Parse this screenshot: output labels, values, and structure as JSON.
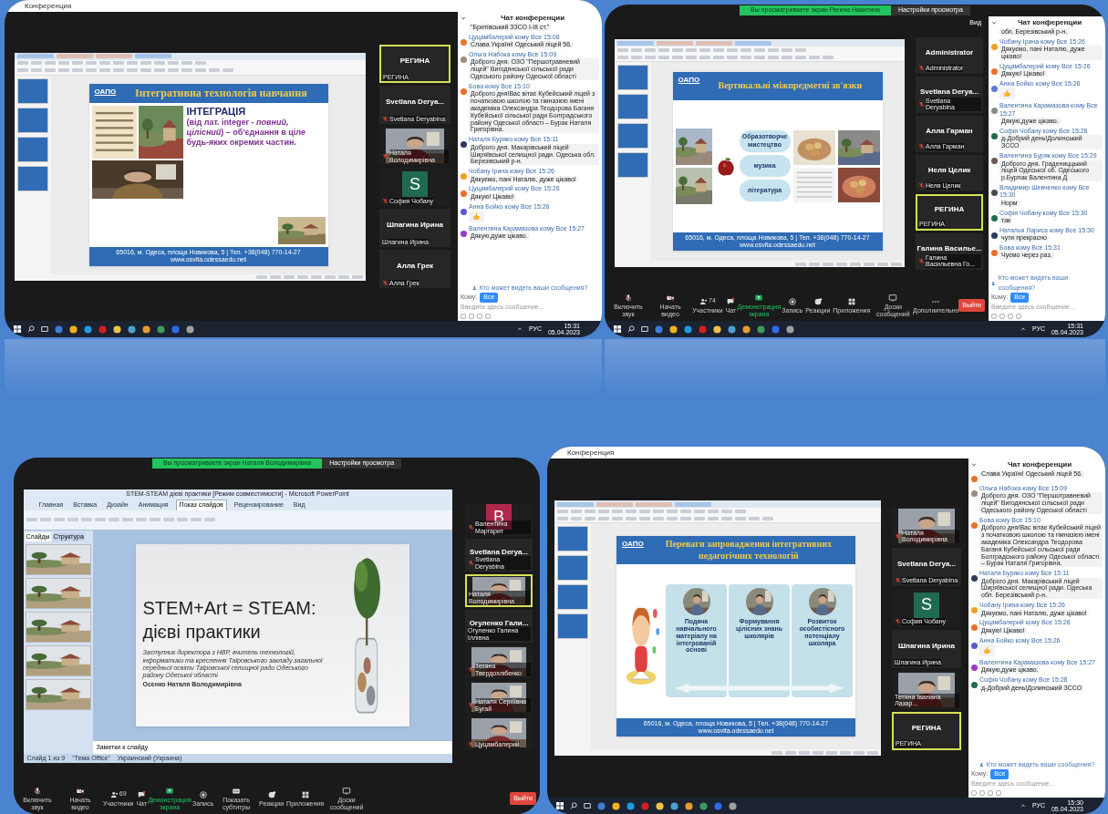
{
  "panels": [
    {
      "window_title": "Конференция",
      "app": {
        "kind": "wps",
        "slide": {
          "kind": "integration",
          "logo": "ОАПО",
          "title": "Інтегративна технологія навчання",
          "heading": "ІНТЕГРАЦІЯ",
          "body": "(від лат. integer - *повний, цілісний*) – об'єднання в ціле будь-яких окремих частин.",
          "footer": "65016, м. Одеса, площа Новикова, 5 | Тел. +38(048) 770-14-27",
          "website": "www.osvita.odessaedu.net"
        }
      },
      "participants": [
        {
          "kind": "name",
          "name": "РЕГИНА",
          "label": "РЕГИНА",
          "muted": false,
          "active": true
        },
        {
          "kind": "name",
          "name": "Svetlana Derya...",
          "label": "Svetlana Deryabina",
          "muted": true,
          "active": false
        },
        {
          "kind": "video",
          "label": "Наталя Володимирівна",
          "muted": true,
          "active": false
        },
        {
          "kind": "avatar",
          "letter": "S",
          "color": "#1f6b4f",
          "label": "София Чобану",
          "muted": true,
          "active": false
        },
        {
          "kind": "name",
          "name": "Шпагина Ирина",
          "label": "Шпагина Ирина",
          "muted": false,
          "active": false
        },
        {
          "kind": "name",
          "name": "Алла Грек",
          "label": "Алла Грек",
          "muted": true,
          "active": false
        }
      ],
      "chat": {
        "title": "Чат конференции",
        "messages": [
          {
            "kind": "text",
            "text": "\"Бритівський ЗЗСО І-ІІІ ст.\""
          },
          {
            "kind": "text",
            "author": "Цуцамбалерий кому Все 15:08",
            "text": "Слава Україні! Одеський ліцей 56.",
            "color": "#e8702a"
          },
          {
            "kind": "text",
            "author": "Ольга Набока кому Все 15:09",
            "text": "Доброго дня. ОЗО \"Першотравневий ліцей\" Вигодянської сільської ради Одеського району Одеської області",
            "color": "#9a8a80"
          },
          {
            "kind": "text",
            "author": "Бова кому Все 15:10",
            "text": "Доброго дня!Вас вітає Кубейський ліцей з початковою школою та гімназією імені академіка Олександра Теодорова Баганя Кубейської сільської ради Болградського району Одеської області – Бурак Наталя Григорівна.",
            "color": "#e8702a"
          },
          {
            "kind": "text",
            "author": "Наталя Буряко кому Все 15:11",
            "text": "Доброго дня. Макарівський ліцей Ширяївської селищної ради. Одеська обл. Березівський р-н.",
            "color": "#2a3a5a"
          },
          {
            "kind": "text",
            "author": "Чобану Ірина кому Все 15:26",
            "text": "Дякуємо, пані Наталю, дуже цікаво!",
            "color": "#f0a020"
          },
          {
            "kind": "text",
            "author": "Цуцамбалерий кому Все 15:26",
            "text": "Дякую! Цікаво!",
            "color": "#e8702a"
          },
          {
            "kind": "reaction",
            "author": "Анна Бойко кому Все 15:26",
            "color": "#5a5ac8"
          },
          {
            "kind": "text",
            "author": "Валентина Карамазова кому Все 15:27",
            "text": "Дякую,дуже цікаво.",
            "color": "#9a3ac8"
          }
        ],
        "who_can_see": "Кто может видеть ваши сообщения?",
        "to_label": "Кому:",
        "to_value": "Все",
        "input_placeholder": "Введите здесь сообщение..."
      },
      "taskbar": {
        "lang": "РУС",
        "time": "15:31",
        "date": "05.04.2023"
      }
    },
    {
      "banner": {
        "text": "Вы просматриваете экран Регина Никитина",
        "button": "Настройки просмотра"
      },
      "view_button": "Вид",
      "app": {
        "kind": "wps",
        "slide": {
          "kind": "vertical",
          "logo": "ОАПО",
          "title": "Вертикальні міжпредметні зв'язки",
          "bubbles": [
            "Образотворче мистецтво",
            "музика",
            "література"
          ],
          "footer": "65016, м. Одеса, площа Новикова, 5 | Тел. +38(048) 770-14-27",
          "website": "www.osvita.odessaedu.net"
        }
      },
      "participants": [
        {
          "kind": "name",
          "name": "Administrator",
          "label": "Administrator",
          "muted": true,
          "active": false
        },
        {
          "kind": "name",
          "name": "Svetlana Derya...",
          "label": "Svetlana Deryabina",
          "muted": true,
          "active": false
        },
        {
          "kind": "name",
          "name": "Алла Гарман",
          "label": "Алла Гарман",
          "muted": true,
          "active": false
        },
        {
          "kind": "name",
          "name": "Неля Целик",
          "label": "Неля Целик",
          "muted": true,
          "active": false
        },
        {
          "kind": "name",
          "name": "РЕГИНА",
          "label": "РЕГИНА",
          "muted": false,
          "active": true
        },
        {
          "kind": "name",
          "name": "Галина Василье...",
          "label": "Галина Васильевна Го...",
          "muted": true,
          "active": false
        }
      ],
      "chat": {
        "title": "Чат конференции",
        "messages": [
          {
            "kind": "text",
            "text": "обл. Березівський р-н."
          },
          {
            "kind": "text",
            "author": "Чобану Ірина кому Все 15:26",
            "text": "Дякуємо, пані Наталю, дуже цікаво!",
            "color": "#f0a020"
          },
          {
            "kind": "text",
            "author": "Цуцамбалерий кому Все 15:26",
            "text": "Дякую! Цікаво!",
            "color": "#e8702a"
          },
          {
            "kind": "reaction",
            "author": "Анна Бойко кому Все 15:26",
            "color": "#5a7ad8"
          },
          {
            "kind": "text",
            "author": "Валентина Карамазова кому Все 15:27",
            "text": "Дякую,дуже цікаво.",
            "color": "#8a8a8a"
          },
          {
            "kind": "text",
            "author": "Софія Чобану кому Все 15:28",
            "text": "д-Добрий день!Долинський ЗССО",
            "color": "#1f6b4f"
          },
          {
            "kind": "text",
            "author": "Валентина Буряк кому Все 15:29",
            "text": "Доброго дня. Градениццький ліцей Одеської об. Одеського р.Бурлак Валентина Д",
            "color": "#6a5a50"
          },
          {
            "kind": "text",
            "author": "Владимир Шевченко кому Все 15:30",
            "text": "Норм",
            "color": "#4a4a4a"
          },
          {
            "kind": "text",
            "author": "Софія Чобану кому Все 15:30",
            "text": "так",
            "color": "#1f6b4f"
          },
          {
            "kind": "text",
            "author": "Наталья Лариса кому Все 15:30",
            "text": "чути прекрасно",
            "color": "#2a3a5a"
          },
          {
            "kind": "text",
            "author": "Бова кому Все 15:31",
            "text": "Чуємо через раз.",
            "color": "#e8702a"
          }
        ],
        "who_can_see": "Кто может видеть ваши сообщения?",
        "to_label": "Кому:",
        "to_value": "Все",
        "input_placeholder": "Введите здесь сообщение..."
      },
      "toolbar": [
        {
          "kind": "audio",
          "label": "Включить звук"
        },
        {
          "kind": "video",
          "label": "Начать видео"
        },
        {
          "kind": "participants",
          "label": "Участники",
          "count": "74"
        },
        {
          "kind": "chat",
          "label": "Чат"
        },
        {
          "kind": "share",
          "label": "Демонстрация экрана"
        },
        {
          "kind": "record",
          "label": "Запись"
        },
        {
          "kind": "reactions",
          "label": "Реакции"
        },
        {
          "kind": "apps",
          "label": "Приложения"
        },
        {
          "kind": "whiteboards",
          "label": "Доски сообщений"
        },
        {
          "kind": "more",
          "label": "Дополнительно"
        }
      ],
      "leave_button": "Выйти",
      "taskbar": {
        "lang": "РУС",
        "time": "15:31",
        "date": "05.04.2023"
      }
    },
    {
      "banner": {
        "text": "Вы просматриваете экран Наталя Володимирівна",
        "button": "Настройки просмотра"
      },
      "app": {
        "kind": "powerpoint",
        "title": "STEM-STEAM дієві практики [Режим совместимости] - Microsoft PowerPoint",
        "tabs": [
          {
            "label": "Главная",
            "selected": false
          },
          {
            "label": "Вставка",
            "selected": false
          },
          {
            "label": "Дизайн",
            "selected": false
          },
          {
            "label": "Анимация",
            "selected": false
          },
          {
            "label": "Показ слайдов",
            "selected": true
          },
          {
            "label": "Рецензирование",
            "selected": false
          },
          {
            "label": "Вид",
            "selected": false
          }
        ],
        "pane_tabs": [
          {
            "label": "Слайды",
            "selected": true
          },
          {
            "label": "Структура",
            "selected": false
          }
        ],
        "notes": "Заметки к слайду",
        "status": [
          "Слайд 1 из 9",
          "\"Тема Office\"",
          "Украинский (Украина)"
        ],
        "slide": {
          "kind": "stem",
          "title": "STEM+Art = STEAM: дієві практики",
          "caption": "Заступник директора з НВР, вчитель технологій, інформатики та креслення Таїровського закладу загальної середньої освіти Таїровської селищної ради Одеського району Одеської області",
          "author": "Осєнко Наталя Володимирівна"
        }
      },
      "participants": [
        {
          "kind": "avatar",
          "letter": "B",
          "color": "#b0284a",
          "label": "Валентина Маргарит",
          "muted": true,
          "active": false
        },
        {
          "kind": "name",
          "name": "Svetlana Derya...",
          "label": "Svetlana Deryabina",
          "muted": true,
          "active": false
        },
        {
          "kind": "video",
          "label": "Наталя Володимирівна",
          "muted": false,
          "active": true
        },
        {
          "kind": "name",
          "name": "Огуленко Гали...",
          "label": "Огуленко Галина Іллівна",
          "muted": false,
          "active": false
        },
        {
          "kind": "video",
          "label": "Тетяна Твердохлібенко",
          "muted": true,
          "active": false
        },
        {
          "kind": "video",
          "label": "Наталя Сергіївна Бугай",
          "muted": true,
          "active": false
        },
        {
          "kind": "video",
          "label": "Цуцамбалерий",
          "muted": true,
          "active": false
        }
      ],
      "toolbar": [
        {
          "kind": "audio",
          "label": "Включить звук"
        },
        {
          "kind": "video",
          "label": "Начать видео"
        },
        {
          "kind": "participants",
          "label": "Участники",
          "count": "69"
        },
        {
          "kind": "chat",
          "label": "Чат"
        },
        {
          "kind": "share",
          "label": "Демонстрация экрана"
        },
        {
          "kind": "record",
          "label": "Запись"
        },
        {
          "kind": "captions",
          "label": "Показать субтитры"
        },
        {
          "kind": "reactions",
          "label": "Реакции"
        },
        {
          "kind": "apps",
          "label": "Приложения"
        },
        {
          "kind": "whiteboards",
          "label": "Доски сообщений"
        }
      ],
      "leave_button": "Выйти"
    },
    {
      "window_title": "Конференция",
      "app": {
        "kind": "wps",
        "slide": {
          "kind": "advantages",
          "logo": "ОАПО",
          "title": "Переваги запровадження інтегративних педагогічних технологій",
          "cards": [
            "Подача навчального матеріалу на інтегрованій основі",
            "Формування цілісних знань школярів",
            "Розвиток особистісного потенціалу школяра"
          ],
          "footer": "65016, м. Одеса, площа Новикова, 5 | Тел. +38(048) 770-14-27",
          "website": "www.osvita.odessaedu.net"
        }
      },
      "participants": [
        {
          "kind": "video",
          "label": "Наталя Володимирівна",
          "muted": true,
          "active": false
        },
        {
          "kind": "name",
          "name": "Svetlana Derya...",
          "label": "Svetlana Deryabina",
          "muted": true,
          "active": false
        },
        {
          "kind": "avatar",
          "letter": "S",
          "color": "#1f6b4f",
          "label": "София Чобану",
          "muted": true,
          "active": false
        },
        {
          "kind": "name",
          "name": "Шпагина Ирина",
          "label": "Шпагина Ирина",
          "muted": false,
          "active": false
        },
        {
          "kind": "video",
          "label": "Тетяна Іванівна Лазар...",
          "muted": false,
          "active": false
        },
        {
          "kind": "name",
          "name": "РЕГИНА",
          "label": "РЕГИНА",
          "muted": false,
          "active": true
        }
      ],
      "chat": {
        "title": "Чат конференции",
        "messages": [
          {
            "kind": "text",
            "text": "Слава Україні! Одеський ліцей 56.",
            "color": "#e8702a"
          },
          {
            "kind": "text",
            "author": "Ольга Набока кому Все 15:09",
            "text": "Доброго дня. ОЗО \"Першотравневий ліцей\" Вигодянської сільської ради Одеського району Одеської області",
            "color": "#9a8a80"
          },
          {
            "kind": "text",
            "author": "Бова кому Все 15:10",
            "text": "Доброго дня!Вас вітає Кубейський ліцей з початковою школою та гімназією імені академіка Олександра Теодорова Баганя Кубейської сільської ради Болградського району Одеської області – Бурак Наталя Григорівна.",
            "color": "#e8702a"
          },
          {
            "kind": "text",
            "author": "Наталя Буряко кому Все 15:11",
            "text": "Доброго дня. Макарівський ліцей Ширяївської селищної ради. Одеська обл. Березівський р-н.",
            "color": "#2a3a5a"
          },
          {
            "kind": "text",
            "author": "Чобану Ірина кому Все 15:26",
            "text": "Дякуємо, пані Наталю, дуже цікаво!",
            "color": "#f0a020"
          },
          {
            "kind": "text",
            "author": "Цуцамбалерий кому Все 15:26",
            "text": "Дякую! Цікаво!",
            "color": "#e8702a"
          },
          {
            "kind": "reaction",
            "author": "Анна Бойко кому Все 15:26",
            "color": "#5a5ac8"
          },
          {
            "kind": "text",
            "author": "Валентина Карамазова кому Все 15:27",
            "text": "Дякую,дуже цікаво.",
            "color": "#9a3ac8"
          },
          {
            "kind": "text",
            "author": "Софія Чобану кому Все 15:28",
            "text": "д-Добрий день!Долинський ЗССО",
            "color": "#1f6b4f"
          }
        ],
        "who_can_see": "Кто может видеть ваши сообщения?",
        "to_label": "Кому:",
        "to_value": "Все",
        "input_placeholder": "Введите здесь сообщение..."
      },
      "taskbar": {
        "lang": "РУС",
        "time": "15:30",
        "date": "05.04.2023"
      }
    }
  ]
}
